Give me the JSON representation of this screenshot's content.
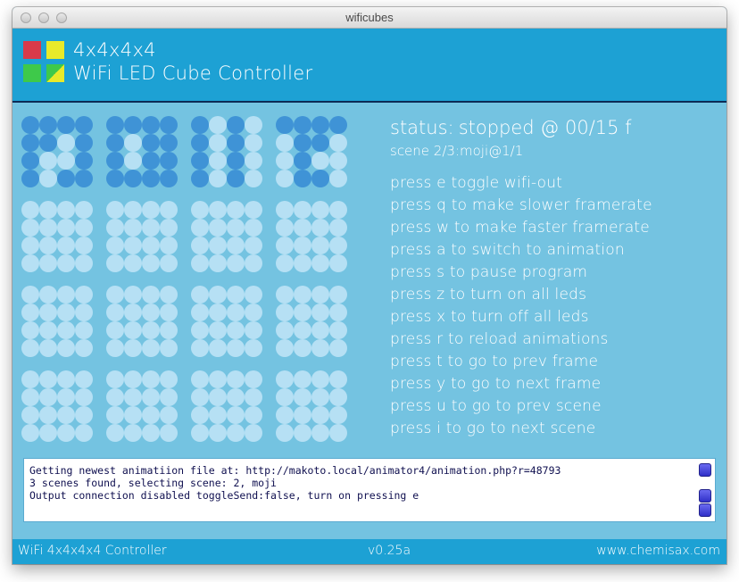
{
  "window": {
    "title": "wificubes"
  },
  "header": {
    "title": "4x4x4x4",
    "subtitle": "WiFi LED Cube Controller",
    "logo_colors": [
      "#d93a4a",
      "#e8ea2a",
      "#3ec94a",
      "#e8ea2a"
    ]
  },
  "colors": {
    "led_on": "#3f93d6",
    "led_off": "#b6e0f4",
    "panel_bg": "#74c3e1",
    "header_bg": "#1da1d4"
  },
  "cube": {
    "rows": [
      [
        [
          "1111",
          "1101",
          "1001",
          "1011"
        ],
        [
          "1111",
          "1011",
          "1011",
          "1111"
        ],
        [
          "1010",
          "1010",
          "1010",
          "1010"
        ],
        [
          "1111",
          "0110",
          "0100",
          "0110"
        ]
      ],
      [
        [
          "0000",
          "0000",
          "0000",
          "0000"
        ],
        [
          "0000",
          "0000",
          "0000",
          "0000"
        ],
        [
          "0000",
          "0000",
          "0000",
          "0000"
        ],
        [
          "0000",
          "0000",
          "0000",
          "0000"
        ]
      ],
      [
        [
          "0000",
          "0000",
          "0000",
          "0000"
        ],
        [
          "0000",
          "0000",
          "0000",
          "0000"
        ],
        [
          "0000",
          "0000",
          "0000",
          "0000"
        ],
        [
          "0000",
          "0000",
          "0000",
          "0000"
        ]
      ],
      [
        [
          "0000",
          "0000",
          "0000",
          "0000"
        ],
        [
          "0000",
          "0000",
          "0000",
          "0000"
        ],
        [
          "0000",
          "0000",
          "0000",
          "0000"
        ],
        [
          "0000",
          "0000",
          "0000",
          "0000"
        ]
      ]
    ]
  },
  "status": {
    "label": "status:",
    "value": "stopped @ 00/15 f",
    "scene": "scene 2/3:moji@1/1"
  },
  "commands": [
    "press e toggle wifi-out",
    "press q to make slower framerate",
    "press w to make faster framerate",
    "press a to switch to animation",
    "press s to pause program",
    "press z to turn on all leds",
    "press x to turn off all leds",
    "press r to reload animations",
    "press t to go to prev frame",
    "press y to go to next frame",
    "press u to go to prev scene",
    "press i to go to next scene"
  ],
  "console": {
    "lines": [
      "Getting newest animatiion file at: http://makoto.local/animator4/animation.php?r=48793",
      "3 scenes found, selecting scene: 2, moji",
      "Output connection disabled toggleSend:false, turn on pressing e"
    ]
  },
  "footer": {
    "left": "WiFi 4x4x4x4 Controller",
    "version": "v0.25a",
    "website": "www.chemisax.com"
  }
}
